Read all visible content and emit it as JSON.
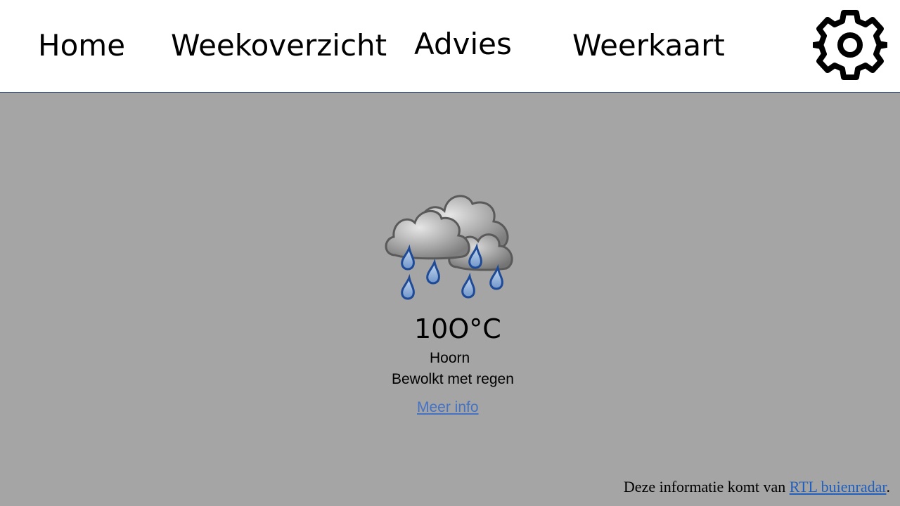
{
  "nav": {
    "home": "Home",
    "week": "Weekoverzicht",
    "advies": "Advies",
    "weerkaart": "Weerkaart"
  },
  "icons": {
    "settings": "gear-icon",
    "weather": "rain-cloud-icon"
  },
  "weather": {
    "temperature": "10O°C",
    "city": "Hoorn",
    "description": "Bewolkt met regen",
    "more_link": "Meer info"
  },
  "footer": {
    "text_before": "Deze informatie komt van ",
    "link": "RTL buienradar",
    "text_after": "."
  },
  "colors": {
    "header_bg": "#ffffff",
    "page_bg": "#a5a5a5",
    "link": "#4472c4",
    "footer_link": "#1f5fbf"
  }
}
